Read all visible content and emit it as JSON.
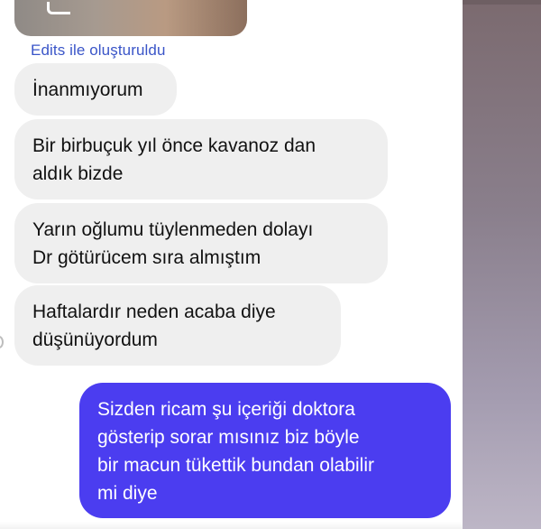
{
  "conversation": {
    "edits_label": "Edits ile oluşturuldu",
    "messages": [
      {
        "side": "received",
        "text": "İnanmıyorum"
      },
      {
        "side": "received",
        "text": "Bir birbuçuk yıl önce kavanoz dan\naldık bizde"
      },
      {
        "side": "received",
        "text": "Yarın oğlumu tüylenmeden dolayı\nDr götürücem sıra almıştım"
      },
      {
        "side": "received",
        "text": "Haftalardır neden acaba diye\ndüşünüyordum"
      },
      {
        "side": "sent",
        "text": "Sizden ricam şu içeriği doktora\ngösterip sorar mısınız biz böyle\nbir macun tükettik bundan olabilir\nmi diye"
      }
    ]
  },
  "colors": {
    "received_bubble": "#efefef",
    "sent_bubble": "#4b3df0",
    "edits_label": "#3a55c8"
  }
}
